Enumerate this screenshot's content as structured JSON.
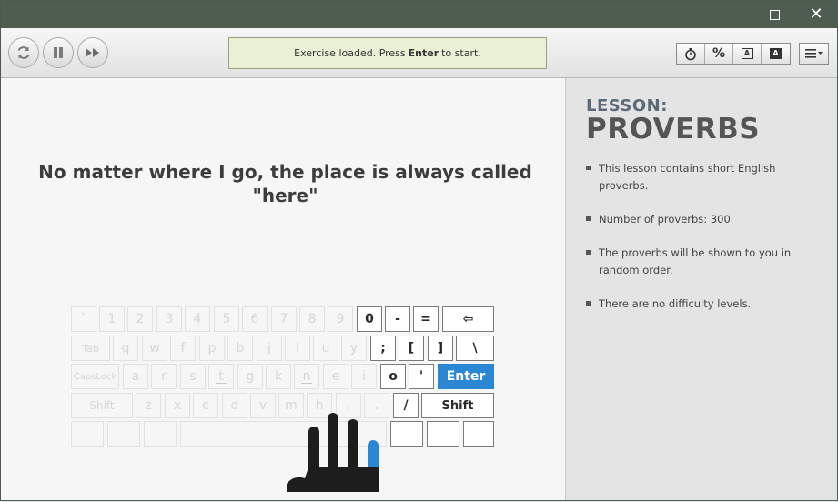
{
  "window": {
    "minimize": "minimize",
    "maximize": "maximize",
    "close": "✕"
  },
  "toolbar": {
    "status_prefix": "Exercise loaded. Press",
    "status_key": "Enter",
    "status_suffix": "to start.",
    "percent_label": "%",
    "font_a_label": "A",
    "font_a_fill_label": "A",
    "icons": [
      "reload-icon",
      "pause-icon",
      "fast-forward-icon",
      "stopwatch-icon",
      "menu-icon"
    ]
  },
  "exercise": {
    "phrase": "No matter where I go, the place is always called \"here\""
  },
  "sidebar": {
    "lesson_label": "LESSON:",
    "lesson_title": "PROVERBS",
    "bullets": [
      "This lesson contains short English proverbs.",
      "Number of proverbs: 300.",
      "The proverbs will be shown to you in random order.",
      "There are no difficulty levels."
    ]
  },
  "keyboard": {
    "row1": [
      "`",
      "1",
      "2",
      "3",
      "4",
      "5",
      "6",
      "7",
      "8",
      "9",
      "0",
      "-",
      "=",
      "⇦"
    ],
    "row2": [
      "Tab",
      "q",
      "w",
      "f",
      "p",
      "b",
      "j",
      "l",
      "u",
      "y",
      ";",
      "[",
      "]",
      "\\"
    ],
    "row3": [
      "CapsLock",
      "a",
      "r",
      "s",
      "t",
      "g",
      "k",
      "n",
      "e",
      "i",
      "o",
      "'",
      "Enter"
    ],
    "row4": [
      "Shift",
      "z",
      "x",
      "c",
      "d",
      "v",
      "m",
      "h",
      ",",
      ".",
      "/",
      "Shift"
    ],
    "active_keys": [
      "0",
      "-",
      "=",
      "⇦",
      ";",
      "[",
      "]",
      "\\",
      "o",
      "'",
      "/",
      "Shift-right"
    ],
    "highlight_key": "Enter",
    "accent_color": "#2b86d3"
  }
}
